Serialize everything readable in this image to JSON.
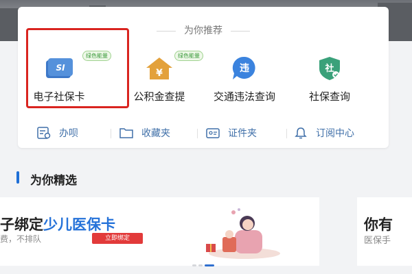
{
  "recommend": {
    "title": "为你推荐",
    "services": [
      {
        "label": "电子社保卡",
        "icon": "social-security-card-icon",
        "badge": "绿色能量"
      },
      {
        "label": "公积金查提",
        "icon": "housing-fund-icon",
        "badge": "绿色能量"
      },
      {
        "label": "交通违法查询",
        "icon": "traffic-violation-icon",
        "glyph": "违"
      },
      {
        "label": "社保查询",
        "icon": "social-security-query-icon",
        "glyph": "社"
      }
    ],
    "actions": [
      {
        "label": "办呗",
        "icon": "service-list-icon"
      },
      {
        "label": "收藏夹",
        "icon": "folder-icon"
      },
      {
        "label": "证件夹",
        "icon": "id-card-icon"
      },
      {
        "label": "订阅中心",
        "icon": "bell-icon"
      }
    ]
  },
  "featured": {
    "title": "为你精选",
    "banner": {
      "title_prefix": "子绑定",
      "title_highlight": "少儿医保卡",
      "subtitle": "费，不排队",
      "button": "立即绑定"
    },
    "banner_next": {
      "title": "你有",
      "subtitle": "医保手"
    }
  },
  "colors": {
    "accent_blue": "#2572d9",
    "highlight_red": "#d9241f",
    "badge_green": "#3d9b3d"
  }
}
